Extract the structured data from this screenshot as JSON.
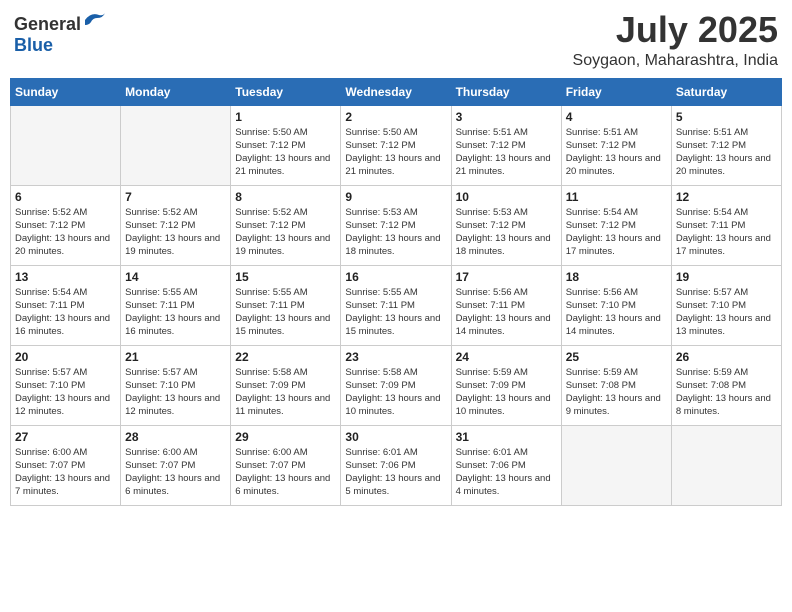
{
  "header": {
    "logo_general": "General",
    "logo_blue": "Blue",
    "month_year": "July 2025",
    "location": "Soygaon, Maharashtra, India"
  },
  "days_of_week": [
    "Sunday",
    "Monday",
    "Tuesday",
    "Wednesday",
    "Thursday",
    "Friday",
    "Saturday"
  ],
  "weeks": [
    [
      {
        "day": "",
        "empty": true
      },
      {
        "day": "",
        "empty": true
      },
      {
        "day": "1",
        "sunrise": "Sunrise: 5:50 AM",
        "sunset": "Sunset: 7:12 PM",
        "daylight": "Daylight: 13 hours and 21 minutes."
      },
      {
        "day": "2",
        "sunrise": "Sunrise: 5:50 AM",
        "sunset": "Sunset: 7:12 PM",
        "daylight": "Daylight: 13 hours and 21 minutes."
      },
      {
        "day": "3",
        "sunrise": "Sunrise: 5:51 AM",
        "sunset": "Sunset: 7:12 PM",
        "daylight": "Daylight: 13 hours and 21 minutes."
      },
      {
        "day": "4",
        "sunrise": "Sunrise: 5:51 AM",
        "sunset": "Sunset: 7:12 PM",
        "daylight": "Daylight: 13 hours and 20 minutes."
      },
      {
        "day": "5",
        "sunrise": "Sunrise: 5:51 AM",
        "sunset": "Sunset: 7:12 PM",
        "daylight": "Daylight: 13 hours and 20 minutes."
      }
    ],
    [
      {
        "day": "6",
        "sunrise": "Sunrise: 5:52 AM",
        "sunset": "Sunset: 7:12 PM",
        "daylight": "Daylight: 13 hours and 20 minutes."
      },
      {
        "day": "7",
        "sunrise": "Sunrise: 5:52 AM",
        "sunset": "Sunset: 7:12 PM",
        "daylight": "Daylight: 13 hours and 19 minutes."
      },
      {
        "day": "8",
        "sunrise": "Sunrise: 5:52 AM",
        "sunset": "Sunset: 7:12 PM",
        "daylight": "Daylight: 13 hours and 19 minutes."
      },
      {
        "day": "9",
        "sunrise": "Sunrise: 5:53 AM",
        "sunset": "Sunset: 7:12 PM",
        "daylight": "Daylight: 13 hours and 18 minutes."
      },
      {
        "day": "10",
        "sunrise": "Sunrise: 5:53 AM",
        "sunset": "Sunset: 7:12 PM",
        "daylight": "Daylight: 13 hours and 18 minutes."
      },
      {
        "day": "11",
        "sunrise": "Sunrise: 5:54 AM",
        "sunset": "Sunset: 7:12 PM",
        "daylight": "Daylight: 13 hours and 17 minutes."
      },
      {
        "day": "12",
        "sunrise": "Sunrise: 5:54 AM",
        "sunset": "Sunset: 7:11 PM",
        "daylight": "Daylight: 13 hours and 17 minutes."
      }
    ],
    [
      {
        "day": "13",
        "sunrise": "Sunrise: 5:54 AM",
        "sunset": "Sunset: 7:11 PM",
        "daylight": "Daylight: 13 hours and 16 minutes."
      },
      {
        "day": "14",
        "sunrise": "Sunrise: 5:55 AM",
        "sunset": "Sunset: 7:11 PM",
        "daylight": "Daylight: 13 hours and 16 minutes."
      },
      {
        "day": "15",
        "sunrise": "Sunrise: 5:55 AM",
        "sunset": "Sunset: 7:11 PM",
        "daylight": "Daylight: 13 hours and 15 minutes."
      },
      {
        "day": "16",
        "sunrise": "Sunrise: 5:55 AM",
        "sunset": "Sunset: 7:11 PM",
        "daylight": "Daylight: 13 hours and 15 minutes."
      },
      {
        "day": "17",
        "sunrise": "Sunrise: 5:56 AM",
        "sunset": "Sunset: 7:11 PM",
        "daylight": "Daylight: 13 hours and 14 minutes."
      },
      {
        "day": "18",
        "sunrise": "Sunrise: 5:56 AM",
        "sunset": "Sunset: 7:10 PM",
        "daylight": "Daylight: 13 hours and 14 minutes."
      },
      {
        "day": "19",
        "sunrise": "Sunrise: 5:57 AM",
        "sunset": "Sunset: 7:10 PM",
        "daylight": "Daylight: 13 hours and 13 minutes."
      }
    ],
    [
      {
        "day": "20",
        "sunrise": "Sunrise: 5:57 AM",
        "sunset": "Sunset: 7:10 PM",
        "daylight": "Daylight: 13 hours and 12 minutes."
      },
      {
        "day": "21",
        "sunrise": "Sunrise: 5:57 AM",
        "sunset": "Sunset: 7:10 PM",
        "daylight": "Daylight: 13 hours and 12 minutes."
      },
      {
        "day": "22",
        "sunrise": "Sunrise: 5:58 AM",
        "sunset": "Sunset: 7:09 PM",
        "daylight": "Daylight: 13 hours and 11 minutes."
      },
      {
        "day": "23",
        "sunrise": "Sunrise: 5:58 AM",
        "sunset": "Sunset: 7:09 PM",
        "daylight": "Daylight: 13 hours and 10 minutes."
      },
      {
        "day": "24",
        "sunrise": "Sunrise: 5:59 AM",
        "sunset": "Sunset: 7:09 PM",
        "daylight": "Daylight: 13 hours and 10 minutes."
      },
      {
        "day": "25",
        "sunrise": "Sunrise: 5:59 AM",
        "sunset": "Sunset: 7:08 PM",
        "daylight": "Daylight: 13 hours and 9 minutes."
      },
      {
        "day": "26",
        "sunrise": "Sunrise: 5:59 AM",
        "sunset": "Sunset: 7:08 PM",
        "daylight": "Daylight: 13 hours and 8 minutes."
      }
    ],
    [
      {
        "day": "27",
        "sunrise": "Sunrise: 6:00 AM",
        "sunset": "Sunset: 7:07 PM",
        "daylight": "Daylight: 13 hours and 7 minutes."
      },
      {
        "day": "28",
        "sunrise": "Sunrise: 6:00 AM",
        "sunset": "Sunset: 7:07 PM",
        "daylight": "Daylight: 13 hours and 6 minutes."
      },
      {
        "day": "29",
        "sunrise": "Sunrise: 6:00 AM",
        "sunset": "Sunset: 7:07 PM",
        "daylight": "Daylight: 13 hours and 6 minutes."
      },
      {
        "day": "30",
        "sunrise": "Sunrise: 6:01 AM",
        "sunset": "Sunset: 7:06 PM",
        "daylight": "Daylight: 13 hours and 5 minutes."
      },
      {
        "day": "31",
        "sunrise": "Sunrise: 6:01 AM",
        "sunset": "Sunset: 7:06 PM",
        "daylight": "Daylight: 13 hours and 4 minutes."
      },
      {
        "day": "",
        "empty": true
      },
      {
        "day": "",
        "empty": true
      }
    ]
  ]
}
